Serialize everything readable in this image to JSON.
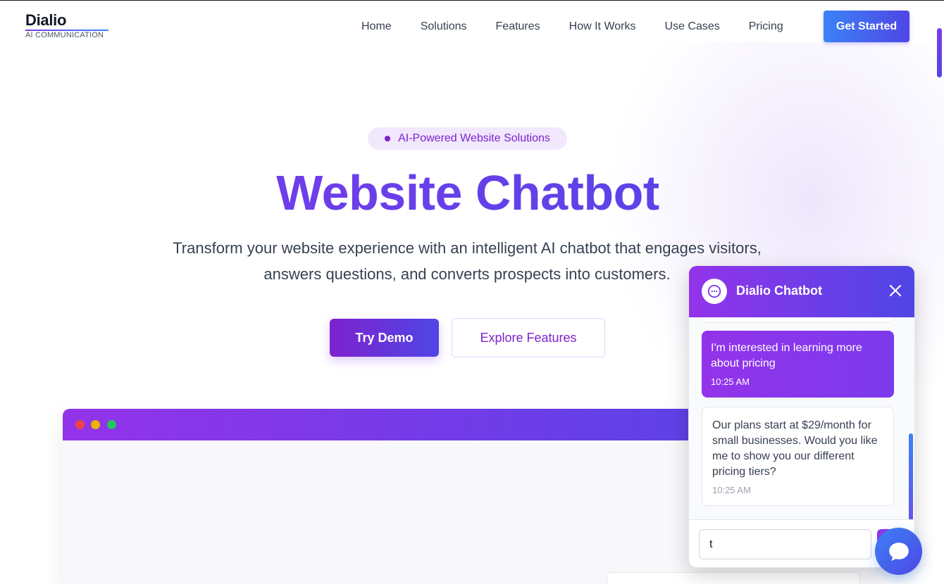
{
  "nav": {
    "logo_name": "Dialio",
    "logo_sub": "AI COMMUNICATION",
    "links": [
      "Home",
      "Solutions",
      "Features",
      "How It Works",
      "Use Cases",
      "Pricing"
    ],
    "cta": "Get Started"
  },
  "hero": {
    "badge": "AI-Powered Website Solutions",
    "title": "Website Chatbot",
    "subtitle": "Transform your website experience with an intelligent AI chatbot that engages visitors, answers questions, and converts prospects into customers.",
    "primary_button": "Try Demo",
    "secondary_button": "Explore Features"
  },
  "mock": {
    "dots": [
      "#ef4444",
      "#eab308",
      "#22c55e"
    ]
  },
  "chat": {
    "title": "Dialio Chatbot",
    "close_icon": "close-icon",
    "messages": [
      {
        "from": "user",
        "text": "I'm interested in learning more about pricing",
        "time": "10:25 AM"
      },
      {
        "from": "bot",
        "text": "Our plans start at $29/month for small businesses. Would you like me to show you our different pricing tiers?",
        "time": "10:25 AM"
      }
    ],
    "input_value": "t"
  },
  "colors": {
    "brand_purple": "#7c3aed",
    "brand_indigo": "#4f46e5",
    "brand_blue": "#3b82f6"
  }
}
